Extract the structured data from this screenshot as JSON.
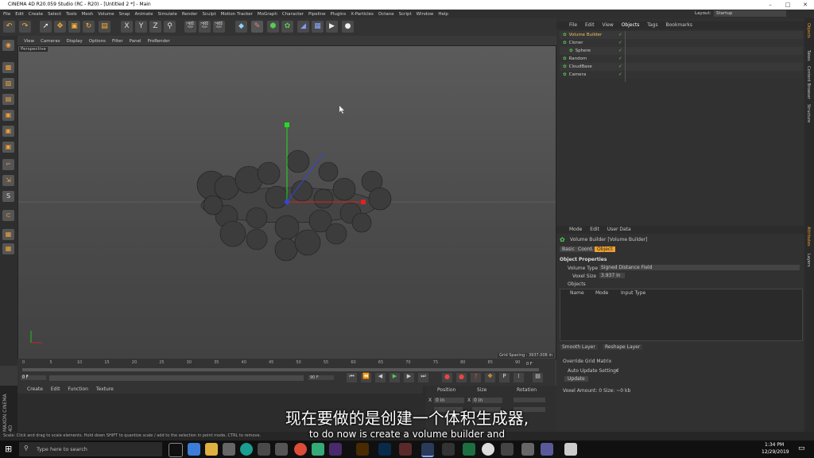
{
  "window": {
    "title": "CINEMA 4D R20.059 Studio (RC - R20) - [Untitled 2 *] - Main"
  },
  "menu": [
    "File",
    "Edit",
    "Create",
    "Select",
    "Tools",
    "Mesh",
    "Volume",
    "Snap",
    "Animate",
    "Simulate",
    "Render",
    "Sculpt",
    "Motion Tracker",
    "MoGraph",
    "Character",
    "Pipeline",
    "Plugins",
    "X-Particles",
    "Octane",
    "Script",
    "Window",
    "Help"
  ],
  "layout": {
    "label": "Layout:",
    "value": "Startup"
  },
  "viewport": {
    "menu": [
      "View",
      "Cameras",
      "Display",
      "Options",
      "Filter",
      "Panel",
      "ProRender"
    ],
    "label": "Perspective",
    "grid_spacing": "Grid Spacing : 3937.008 in"
  },
  "timeline": {
    "ticks": [
      "0",
      "5",
      "10",
      "15",
      "20",
      "25",
      "30",
      "35",
      "40",
      "45",
      "50",
      "55",
      "60",
      "65",
      "70",
      "75",
      "80",
      "85",
      "90"
    ],
    "current_frame": "0 F",
    "start": "0 F",
    "end": "90 F",
    "end2": "90 F",
    "end_label": "0 F"
  },
  "material": {
    "menu": [
      "Create",
      "Edit",
      "Function",
      "Texture"
    ],
    "brand": "MAXON CINEMA 4D"
  },
  "coords": {
    "headers": [
      "Position",
      "Size",
      "Rotation"
    ],
    "x": "0 in",
    "xlabel": "X",
    "sx": "X",
    "sxv": "0 in"
  },
  "objects_panel": {
    "menu": [
      "File",
      "Edit",
      "View",
      "Objects",
      "Tags",
      "Bookmarks"
    ],
    "items": [
      {
        "name": "Volume Builder",
        "selected": true
      },
      {
        "name": "Cloner",
        "selected": false
      },
      {
        "name": "Sphere",
        "selected": false
      },
      {
        "name": "Random",
        "selected": false
      },
      {
        "name": "CloudBase",
        "selected": false
      },
      {
        "name": "Camera",
        "selected": false
      }
    ]
  },
  "attributes": {
    "menu": [
      "Mode",
      "Edit",
      "User Data"
    ],
    "object_title": "Volume Builder [Volume Builder]",
    "tabs": [
      "Basic",
      "Coord.",
      "Object"
    ],
    "section": "Object Properties",
    "volume_type_label": "Volume Type",
    "volume_type_value": "Signed Distance Field",
    "voxel_size_label": "Voxel Size",
    "voxel_size_value": "3.937 in",
    "objects_label": "Objects",
    "columns": [
      "Name",
      "Mode",
      "Input Type"
    ],
    "layer_buttons": [
      "Smooth Layer",
      "Reshape Layer"
    ],
    "override": "Override Grid Matrix",
    "auto_update": "Auto Update Settings",
    "update_btn": "Update",
    "voxel_amount": "Voxel Amount: 0   Size: ~0 kb"
  },
  "side_tabs": [
    "Objects",
    "Takes",
    "Content Browser",
    "Structure"
  ],
  "side_tabs2": [
    "Attributes",
    "Layers"
  ],
  "statusbar": "Scale: Click and drag to scale elements. Hold down SHIFT to quantize scale / add to the selection in point mode, CTRL to remove.",
  "subtitle": {
    "zh": "现在要做的是创建一个体积生成器,",
    "en": "to do now is create a volume builder and"
  },
  "taskbar": {
    "search": "Type here to search",
    "time": "1:34 PM",
    "date": "12/29/2019"
  },
  "colors": {
    "accent": "#f0a030",
    "selected": "#5b6e3a",
    "axis_y": "#22dd22",
    "axis_x": "#dd2222",
    "axis_z": "#3344dd"
  }
}
